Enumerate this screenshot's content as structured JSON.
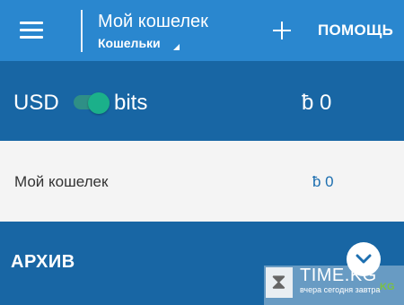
{
  "app_bar": {
    "title": "Мой кошелек",
    "subtitle": "Кошельки",
    "help_label": "ПОМОЩЬ",
    "menu_icon": "hamburger-menu-icon",
    "add_icon": "plus-icon",
    "color": "#2a87cf"
  },
  "balance_bar": {
    "currency_left": "USD",
    "currency_right": "bits",
    "toggle_on": true,
    "total": "ƀ 0",
    "color": "#1866a4"
  },
  "wallets": [
    {
      "name": "Мой кошелек",
      "balance": "ƀ 0"
    }
  ],
  "archive": {
    "label": "АРХИВ",
    "expand_icon": "chevron-down-icon"
  },
  "watermark": {
    "text": "TIME.KG",
    "tag": ".KG",
    "slogan": "вчера сегодня завтра"
  }
}
